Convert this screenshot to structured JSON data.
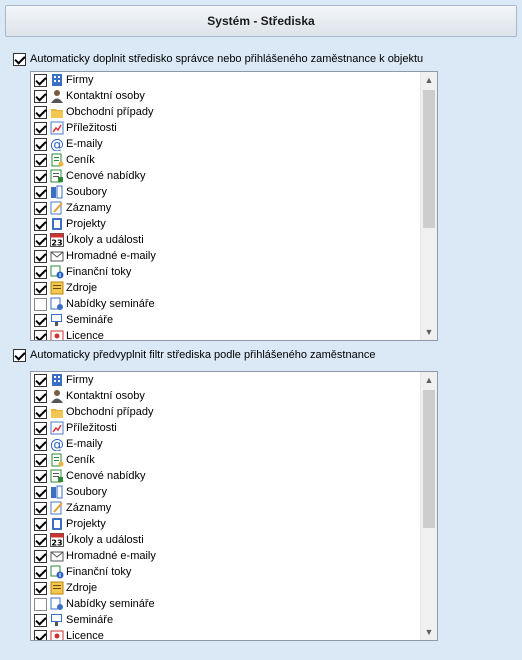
{
  "header": {
    "title": "Systém - Střediska"
  },
  "section1": {
    "label": "Automaticky doplnit středisko správce nebo přihlášeného zaměstnance k objektu",
    "checked": true
  },
  "section2": {
    "label": "Automaticky předvyplnit filtr střediska podle přihlášeného zaměstnance",
    "checked": true
  },
  "list_items": [
    {
      "label": "Firmy",
      "checked": true,
      "icon": "building-icon"
    },
    {
      "label": "Kontaktní osoby",
      "checked": true,
      "icon": "person-icon"
    },
    {
      "label": "Obchodní případy",
      "checked": true,
      "icon": "folder-icon"
    },
    {
      "label": "Příležitosti",
      "checked": true,
      "icon": "chart-icon"
    },
    {
      "label": "E-maily",
      "checked": true,
      "icon": "at-icon"
    },
    {
      "label": "Ceník",
      "checked": true,
      "icon": "price-list-icon"
    },
    {
      "label": "Cenové nabídky",
      "checked": true,
      "icon": "quote-icon"
    },
    {
      "label": "Soubory",
      "checked": true,
      "icon": "files-icon"
    },
    {
      "label": "Záznamy",
      "checked": true,
      "icon": "notes-icon"
    },
    {
      "label": "Projekty",
      "checked": true,
      "icon": "project-icon"
    },
    {
      "label": "Úkoly a události",
      "checked": true,
      "icon": "calendar-icon",
      "icon_text": "23"
    },
    {
      "label": "Hromadné e-maily",
      "checked": true,
      "icon": "mass-mail-icon"
    },
    {
      "label": "Finanční toky",
      "checked": true,
      "icon": "finance-icon"
    },
    {
      "label": "Zdroje",
      "checked": true,
      "icon": "resources-icon"
    },
    {
      "label": "Nabídky semináře",
      "checked": false,
      "icon": "seminar-offer-icon"
    },
    {
      "label": "Semináře",
      "checked": true,
      "icon": "seminar-icon"
    },
    {
      "label": "Licence",
      "checked": true,
      "icon": "license-icon"
    }
  ],
  "scrollbar_glyphs": {
    "up": "▲",
    "down": "▼"
  }
}
